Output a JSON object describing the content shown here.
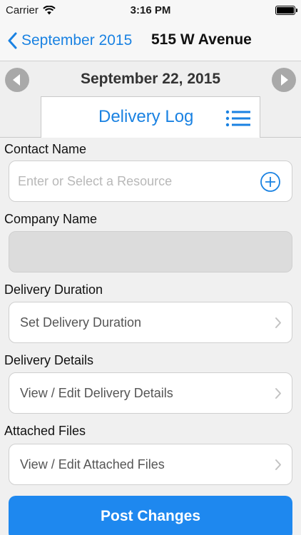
{
  "status_bar": {
    "carrier": "Carrier",
    "time": "3:16 PM"
  },
  "nav": {
    "back_label": "September 2015",
    "title": "515 W Avenue"
  },
  "date_nav": {
    "date": "September 22, 2015"
  },
  "tab": {
    "label": "Delivery Log"
  },
  "form": {
    "contact_name": {
      "label": "Contact Name",
      "placeholder": "Enter or Select a Resource"
    },
    "company_name": {
      "label": "Company Name",
      "value": ""
    },
    "delivery_duration": {
      "label": "Delivery Duration",
      "value": "Set Delivery Duration"
    },
    "delivery_details": {
      "label": "Delivery Details",
      "value": "View / Edit Delivery Details"
    },
    "attached_files": {
      "label": "Attached Files",
      "value": "View / Edit Attached Files"
    }
  },
  "actions": {
    "post_label": "Post Changes"
  },
  "colors": {
    "accent": "#1a82e2",
    "button": "#1e88ef",
    "arrow": "#a9a9a9"
  }
}
